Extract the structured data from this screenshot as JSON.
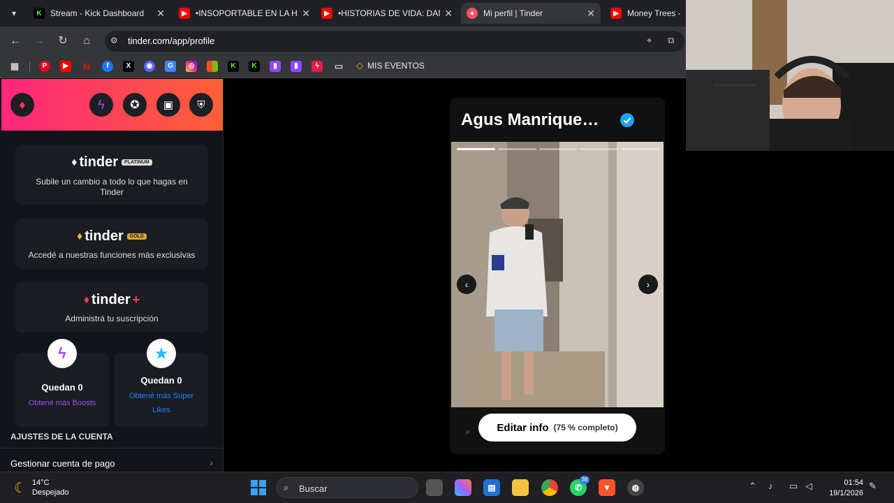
{
  "browser": {
    "tabs": [
      {
        "label": "Stream - Kick Dashboard",
        "icon": "kick-icon",
        "color": "#53fc18",
        "active": false
      },
      {
        "label": "•INSOPORTABLE EN LA HEL",
        "icon": "youtube-icon",
        "color": "#ff0000",
        "active": false
      },
      {
        "label": "•HISTORIAS DE VIDA: DANI",
        "icon": "youtube-icon",
        "color": "#ff0000",
        "active": false
      },
      {
        "label": "Mi perfil | Tinder",
        "icon": "tinder-icon",
        "color": "#fd5068",
        "active": true
      },
      {
        "label": "Money Trees - Yo",
        "icon": "youtube-icon",
        "color": "#ff0000",
        "active": false
      }
    ],
    "url": "tinder.com/app/profile",
    "bookmarks": {
      "events_label": "MIS EVENTOS",
      "icons": [
        "pinterest-icon",
        "youtube-icon",
        "netflix-icon",
        "facebook-icon",
        "x-icon",
        "discord-icon",
        "translate-icon",
        "instagram-icon",
        "microsoft-icon",
        "kick-icon",
        "kick-icon",
        "twitch-icon",
        "twitch-icon",
        "bolt-icon",
        "folder-icon"
      ]
    }
  },
  "sidebar": {
    "platinum": {
      "brand": "tinder",
      "tier": "PLATINUM",
      "desc": "Subile un cambio a todo lo que hagas en Tinder"
    },
    "gold": {
      "brand": "tinder",
      "tier": "GOLD",
      "desc": "Accedé a nuestras funciones más exclusivas"
    },
    "plus": {
      "brand": "tinder",
      "tier": "+",
      "desc": "Administrá tu suscripción"
    },
    "boosts": {
      "count": "Quedan 0",
      "more": "Obtené más Boosts"
    },
    "superlikes": {
      "count": "Quedan 0",
      "more": "Obtené más Super Likes"
    },
    "section_title": "AJUSTES DE LA CUENTA",
    "payment_row": "Gestionar cuenta de pago"
  },
  "profile": {
    "name": "Agus Manrique…",
    "photo_count": 5,
    "current_photo": 1,
    "edit_label": "Editar info",
    "edit_progress": "(75 % completo)"
  },
  "taskbar": {
    "temp": "14°C",
    "weather": "Despejado",
    "search_placeholder": "Buscar",
    "whatsapp_badge": "38",
    "time": "01:54",
    "date": "19/1/2026"
  },
  "colors": {
    "tinder_gradient_start": "#fd267a",
    "tinder_gradient_end": "#ff6036",
    "boost_purple": "#a24cf5",
    "superlike_blue": "#1786ff"
  }
}
